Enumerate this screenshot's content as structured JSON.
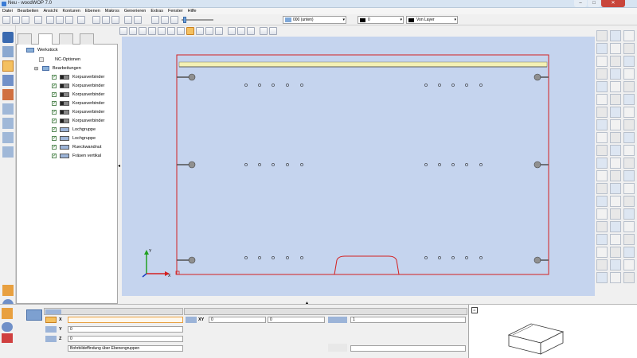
{
  "window": {
    "title": "Neu - woodWOP 7.0",
    "minimize_glyph": "–",
    "maximize_glyph": "□",
    "close_glyph": "✕"
  },
  "menu": [
    "Datei",
    "Bearbeiten",
    "Ansicht",
    "Konturen",
    "Ebenen",
    "Makros",
    "Generieren",
    "Extras",
    "Fenster",
    "Hilfe"
  ],
  "toolbar": {
    "layer_dropdown": "000  (unten)",
    "color_dropdown": "0",
    "linetype_dropdown": "Von Layer"
  },
  "tree": {
    "root": "Werkstück",
    "nc_options": "NC-Optionen",
    "operations_label": "Bearbeitungen",
    "items": [
      {
        "label": "Korpusverbinder",
        "icon": "connector-icon"
      },
      {
        "label": "Korpusverbinder",
        "icon": "connector-icon"
      },
      {
        "label": "Korpusverbinder",
        "icon": "connector-icon"
      },
      {
        "label": "Korpusverbinder",
        "icon": "connector-icon"
      },
      {
        "label": "Korpusverbinder",
        "icon": "connector-icon"
      },
      {
        "label": "Korpusverbinder",
        "icon": "connector-icon"
      },
      {
        "label": "Lochgruppe",
        "icon": "hole-group-icon"
      },
      {
        "label": "Lochgruppe",
        "icon": "hole-group-icon"
      },
      {
        "label": "Rueckwandnut",
        "icon": "groove-icon"
      },
      {
        "label": "Fräsen vertikal",
        "icon": "milling-icon"
      }
    ]
  },
  "viewport": {
    "axis_y": "Y",
    "axis_x": "X",
    "background_color": "#c5d4ee",
    "workpiece_outline_color": "#d42020",
    "strip_color": "#f4f1b4"
  },
  "properties": {
    "x_label": "X",
    "x_value": "",
    "y_label": "Y",
    "y_value": "0",
    "z_label": "Z",
    "z_value": "0",
    "xy_label": "XY",
    "xy_value_1": "0",
    "xy_value_2": "0",
    "count_value": "1",
    "reference_dropdown": "Bohrbildeffindung über Ebenengruppen"
  }
}
